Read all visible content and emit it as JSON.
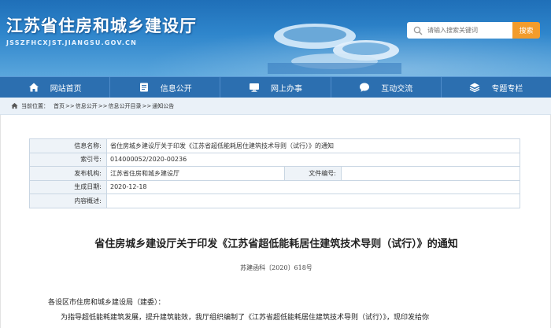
{
  "header": {
    "site_title": "江苏省住房和城乡建设厅",
    "site_url": "JSSZFHCXJST.JIANGSU.GOV.CN",
    "search_placeholder": "请输入搜索关键词",
    "search_button": "搜索"
  },
  "nav": {
    "items": [
      {
        "label": "网站首页",
        "icon": "home-icon"
      },
      {
        "label": "信息公开",
        "icon": "document-icon"
      },
      {
        "label": "网上办事",
        "icon": "monitor-icon"
      },
      {
        "label": "互动交流",
        "icon": "chat-icon"
      },
      {
        "label": "专题专栏",
        "icon": "layers-icon"
      }
    ]
  },
  "breadcrumb": {
    "prefix": "当前位置：",
    "items": [
      "首页",
      "信息公开",
      "信息公开目录",
      "通知公告"
    ],
    "separator": ">>"
  },
  "info_table": {
    "name_label": "信息名称:",
    "name_value": "省住房城乡建设厅关于印发《江苏省超低能耗居住建筑技术导则（试行）》的通知",
    "index_label": "索引号:",
    "index_value": "014000052/2020-00236",
    "org_label": "发布机构:",
    "org_value": "江苏省住房和城乡建设厅",
    "file_no_label": "文件编号:",
    "file_no_value": "",
    "date_label": "生成日期:",
    "date_value": "2020-12-18",
    "summary_label": "内容概述:",
    "summary_value": ""
  },
  "document": {
    "title": "省住房城乡建设厅关于印发《江苏省超低能耗居住建筑技术导则（试行）》的通知",
    "number": "苏建函科〔2020〕618号",
    "salutation": "各设区市住房和城乡建设局（建委）：",
    "paragraph": "为指导超低能耗建筑发展，提升建筑能效，我厅组织编制了《江苏省超低能耗居住建筑技术导则（试行）》，现印发给你"
  },
  "colors": {
    "nav_bg": "#2c6fb0",
    "search_button": "#f39c2c",
    "breadcrumb_bg": "#eaf1f8",
    "table_label_bg": "#eef3f8"
  }
}
